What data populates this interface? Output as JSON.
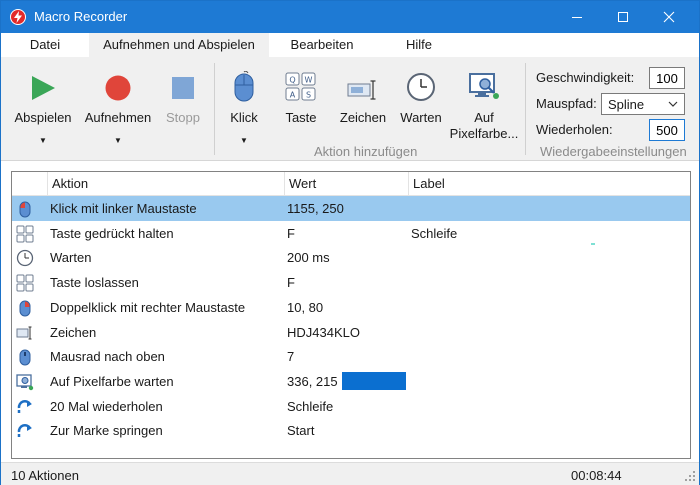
{
  "window": {
    "title": "Macro Recorder"
  },
  "menu": {
    "items": [
      "Datei",
      "Aufnehmen und Abspielen",
      "Bearbeiten",
      "Hilfe"
    ],
    "active": "Aufnehmen und Abspielen"
  },
  "ribbon": {
    "play_label": "Abspielen",
    "record_label": "Aufnehmen",
    "stop_label": "Stopp",
    "click_label": "Klick",
    "key_label": "Taste",
    "key_icon_letters": [
      "Q",
      "W",
      "A",
      "S"
    ],
    "text_label": "Zeichen",
    "wait_label": "Warten",
    "pixel_label_line1": "Auf",
    "pixel_label_line2": "Pixelfarbe...",
    "group_add_action": "Aktion hinzufügen",
    "group_playback_settings": "Wiedergabeeinstellungen",
    "speed_label": "Geschwindigkeit:",
    "speed_value": "100",
    "mouse_path_label": "Mauspfad:",
    "mouse_path_value": "Spline",
    "repeat_label": "Wiederholen:",
    "repeat_value": "500"
  },
  "table": {
    "columns": [
      "Aktion",
      "Wert",
      "Label"
    ],
    "rows": [
      {
        "icon": "mouse-left-icon",
        "action": "Klick mit linker Maustaste",
        "value": "1155, 250",
        "label": "",
        "selected": true
      },
      {
        "icon": "keyboard-icon",
        "action": "Taste gedrückt halten",
        "value": "F",
        "label": "Schleife"
      },
      {
        "icon": "clock-icon",
        "action": "Warten",
        "value": "200 ms",
        "label": ""
      },
      {
        "icon": "keyboard-icon",
        "action": "Taste loslassen",
        "value": "F",
        "label": ""
      },
      {
        "icon": "mouse-right-icon",
        "action": "Doppelklick mit rechter Maustaste",
        "value": "10, 80",
        "label": ""
      },
      {
        "icon": "text-cursor-icon",
        "action": "Zeichen",
        "value": "HDJ434KLO",
        "label": ""
      },
      {
        "icon": "mouse-wheel-icon",
        "action": "Mausrad nach oben",
        "value": "7",
        "label": ""
      },
      {
        "icon": "pixel-color-icon",
        "action": "Auf Pixelfarbe warten",
        "value": "336, 215",
        "label": "",
        "swatch": "#0b6fd0"
      },
      {
        "icon": "repeat-arrow-icon",
        "action": "20 Mal wiederholen",
        "value": "Schleife",
        "label": ""
      },
      {
        "icon": "jump-arrow-icon",
        "action": "Zur Marke springen",
        "value": "Start",
        "label": ""
      }
    ]
  },
  "status": {
    "count": "10 Aktionen",
    "time": "00:08:44"
  },
  "colors": {
    "titlebar": "#1e7ad4",
    "selection": "#99c9ef",
    "play": "#3aa657",
    "record": "#e0453a",
    "stop": "#7fa6d6"
  }
}
